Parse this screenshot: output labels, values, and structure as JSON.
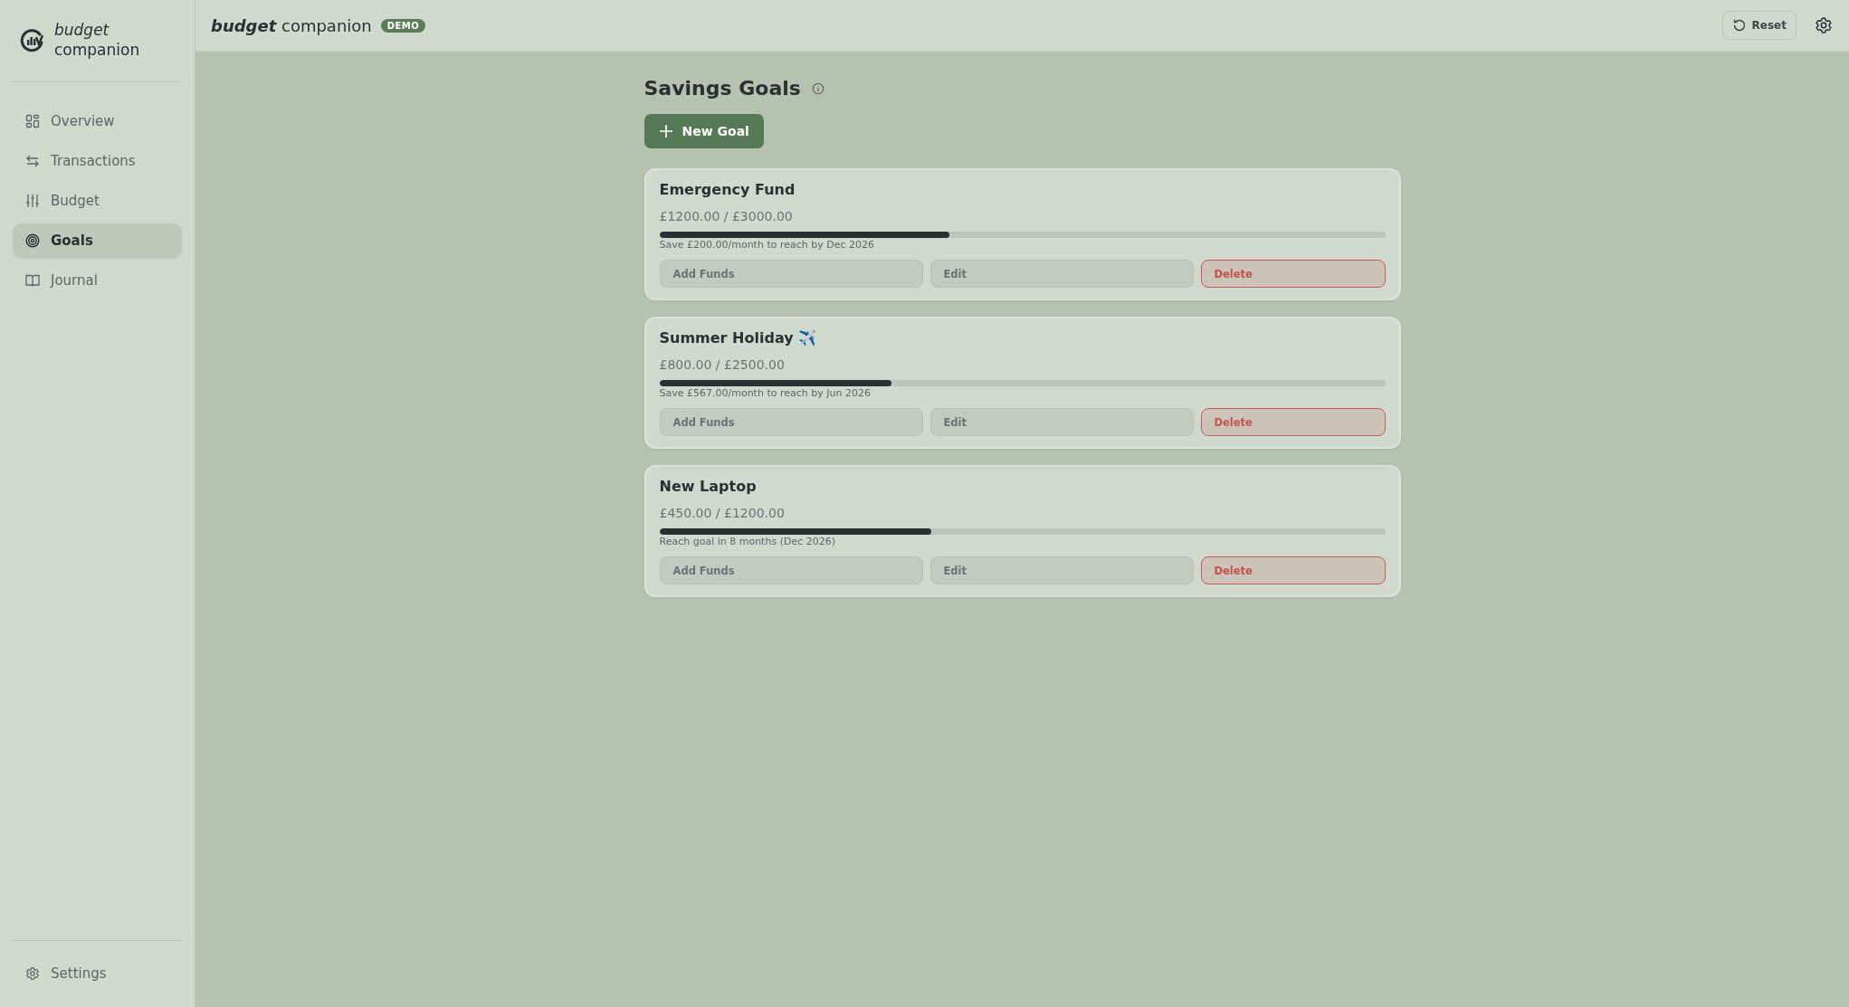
{
  "sidebar": {
    "logo": {
      "line_1": "budget",
      "line_2": "companion"
    },
    "items": [
      {
        "label": "Overview",
        "selected": false
      },
      {
        "label": "Transactions",
        "selected": false
      },
      {
        "label": "Budget",
        "selected": false
      },
      {
        "label": "Goals",
        "selected": true
      },
      {
        "label": "Journal",
        "selected": false
      }
    ],
    "footer_item": {
      "label": "Settings"
    }
  },
  "header": {
    "title_bold": "budget",
    "title_rest": "companion",
    "badge": "DEMO",
    "reset_button": "Reset"
  },
  "page": {
    "title": "Savings Goals",
    "new_goal_button": "New Goal",
    "goals": [
      {
        "name": "Emergency Fund",
        "amount": "£1200.00 / £3000.00",
        "level": 0.4,
        "note": "Save £200.00/month to reach by Dec 2026",
        "actions": [
          "Add Funds",
          "Edit",
          "Delete"
        ]
      },
      {
        "name": "Summer Holiday ✈️",
        "amount": "£800.00 / £2500.00",
        "level": 0.32,
        "note": "Save £567.00/month to reach by Jun 2026",
        "actions": [
          "Add Funds",
          "Edit",
          "Delete"
        ]
      },
      {
        "name": "New Laptop",
        "amount": "£450.00 / £1200.00",
        "level": 0.375,
        "note": "Reach goal in 8 months (Dec 2026)",
        "actions": [
          "Add Funds",
          "Edit",
          "Delete"
        ]
      }
    ]
  }
}
